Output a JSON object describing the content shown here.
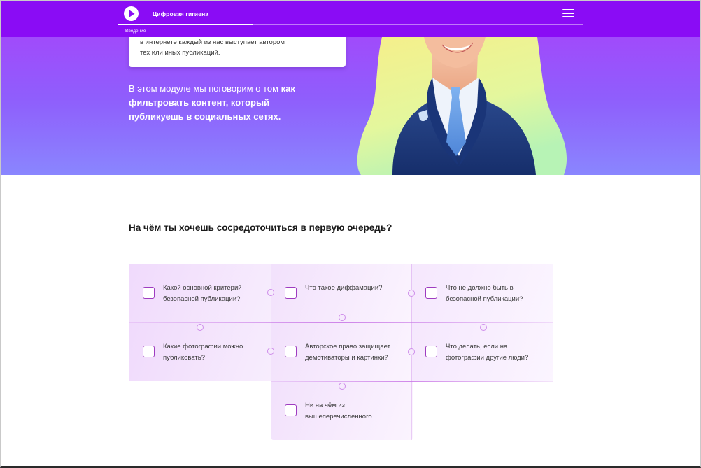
{
  "header": {
    "app_title": "Цифровая гигиена",
    "section_label": "Введение",
    "progress": 0.29
  },
  "hero": {
    "card_text": "в интернете каждый из нас выступает автором\nтех или иных публикаций.",
    "intro_plain": "В этом модуле мы поговорим о том",
    "intro_bold": "как фильтровать контент, который публикуешь в социальных сетях."
  },
  "quiz": {
    "question": "На чём ты хочешь сосредоточиться в первую очередь?",
    "options": [
      "Какой основной критерий безопасной публикации?",
      "Что такое диффамации?",
      "Что не должно быть в безопасной публикации?",
      "Какие фотографии можно публиковать?",
      "Авторское право защищает демотиваторы и картинки?",
      "Что делать, если на фотографии другие люди?",
      "Ни на чём из вышеперечисленного"
    ]
  },
  "icons": {
    "logo": "play-circle-icon",
    "menu": "hamburger-menu-icon"
  },
  "colors": {
    "header": "#8a0cf5",
    "hero_top": "#a04bfb",
    "hero_bottom": "#8a86fe",
    "checkbox_border": "#9e3cc0"
  }
}
